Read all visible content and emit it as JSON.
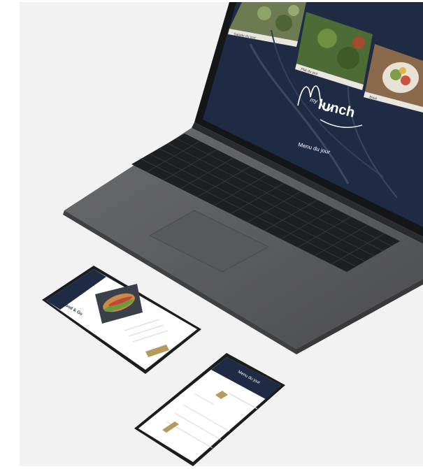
{
  "laptop_screen": {
    "logo_prefix": "my",
    "logo_word": "lunch",
    "tagline": "Menu du jour",
    "background_color": "#1f2a44",
    "tiles": [
      {
        "icon": "salad-leaves-image",
        "label": "Salade du jour"
      },
      {
        "icon": "herb-plate-image",
        "label": "Plat du jour"
      },
      {
        "icon": "bowl-image",
        "label": "Bowl"
      }
    ]
  },
  "phone_left": {
    "title": "Food & Go",
    "item_icon": "sandwich-image",
    "accent_color": "#b49a5e"
  },
  "phone_right": {
    "title": "Menu du jour",
    "accent_color": "#b49a5e",
    "header_color": "#1f2a44"
  },
  "colors": {
    "laptop_body": "#5f6062",
    "keyboard": "#1e1f21",
    "background": "#f2f2f2"
  }
}
